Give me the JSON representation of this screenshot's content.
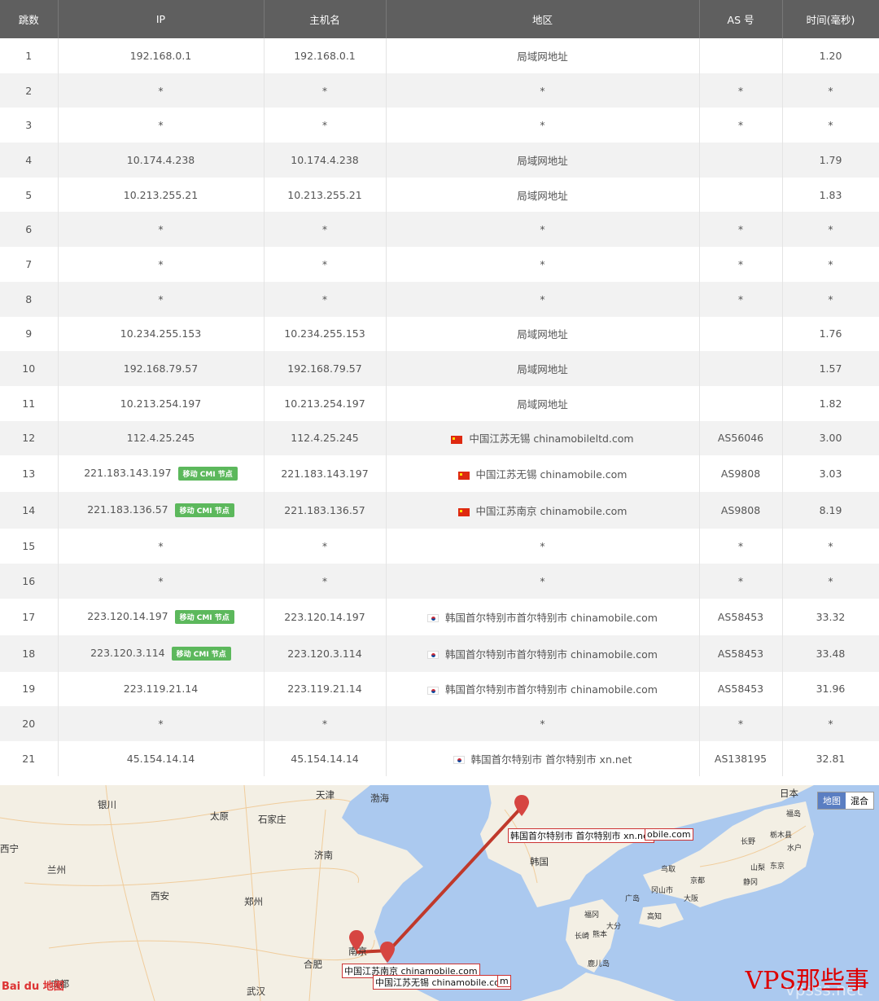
{
  "table": {
    "headers": [
      "跳数",
      "IP",
      "主机名",
      "地区",
      "AS 号",
      "时间(毫秒)"
    ],
    "badge_label": "移动 CMI 节点",
    "rows": [
      {
        "hop": "1",
        "ip": "192.168.0.1",
        "host": "192.168.0.1",
        "region": "局域网地址",
        "flag": "",
        "as": "",
        "time": "1.20",
        "badge": false
      },
      {
        "hop": "2",
        "ip": "*",
        "host": "*",
        "region": "*",
        "flag": "",
        "as": "*",
        "time": "*",
        "badge": false
      },
      {
        "hop": "3",
        "ip": "*",
        "host": "*",
        "region": "*",
        "flag": "",
        "as": "*",
        "time": "*",
        "badge": false
      },
      {
        "hop": "4",
        "ip": "10.174.4.238",
        "host": "10.174.4.238",
        "region": "局域网地址",
        "flag": "",
        "as": "",
        "time": "1.79",
        "badge": false
      },
      {
        "hop": "5",
        "ip": "10.213.255.21",
        "host": "10.213.255.21",
        "region": "局域网地址",
        "flag": "",
        "as": "",
        "time": "1.83",
        "badge": false
      },
      {
        "hop": "6",
        "ip": "*",
        "host": "*",
        "region": "*",
        "flag": "",
        "as": "*",
        "time": "*",
        "badge": false
      },
      {
        "hop": "7",
        "ip": "*",
        "host": "*",
        "region": "*",
        "flag": "",
        "as": "*",
        "time": "*",
        "badge": false
      },
      {
        "hop": "8",
        "ip": "*",
        "host": "*",
        "region": "*",
        "flag": "",
        "as": "*",
        "time": "*",
        "badge": false
      },
      {
        "hop": "9",
        "ip": "10.234.255.153",
        "host": "10.234.255.153",
        "region": "局域网地址",
        "flag": "",
        "as": "",
        "time": "1.76",
        "badge": false
      },
      {
        "hop": "10",
        "ip": "192.168.79.57",
        "host": "192.168.79.57",
        "region": "局域网地址",
        "flag": "",
        "as": "",
        "time": "1.57",
        "badge": false
      },
      {
        "hop": "11",
        "ip": "10.213.254.197",
        "host": "10.213.254.197",
        "region": "局域网地址",
        "flag": "",
        "as": "",
        "time": "1.82",
        "badge": false
      },
      {
        "hop": "12",
        "ip": "112.4.25.245",
        "host": "112.4.25.245",
        "region": "中国江苏无锡 chinamobileltd.com",
        "flag": "cn",
        "as": "AS56046",
        "time": "3.00",
        "badge": false
      },
      {
        "hop": "13",
        "ip": "221.183.143.197",
        "host": "221.183.143.197",
        "region": "中国江苏无锡 chinamobile.com",
        "flag": "cn",
        "as": "AS9808",
        "time": "3.03",
        "badge": true
      },
      {
        "hop": "14",
        "ip": "221.183.136.57",
        "host": "221.183.136.57",
        "region": "中国江苏南京 chinamobile.com",
        "flag": "cn",
        "as": "AS9808",
        "time": "8.19",
        "badge": true
      },
      {
        "hop": "15",
        "ip": "*",
        "host": "*",
        "region": "*",
        "flag": "",
        "as": "*",
        "time": "*",
        "badge": false
      },
      {
        "hop": "16",
        "ip": "*",
        "host": "*",
        "region": "*",
        "flag": "",
        "as": "*",
        "time": "*",
        "badge": false
      },
      {
        "hop": "17",
        "ip": "223.120.14.197",
        "host": "223.120.14.197",
        "region": "韩国首尔特别市首尔特别市 chinamobile.com",
        "flag": "kr",
        "as": "AS58453",
        "time": "33.32",
        "badge": true
      },
      {
        "hop": "18",
        "ip": "223.120.3.114",
        "host": "223.120.3.114",
        "region": "韩国首尔特别市首尔特别市 chinamobile.com",
        "flag": "kr",
        "as": "AS58453",
        "time": "33.48",
        "badge": true
      },
      {
        "hop": "19",
        "ip": "223.119.21.14",
        "host": "223.119.21.14",
        "region": "韩国首尔特别市首尔特别市 chinamobile.com",
        "flag": "kr",
        "as": "AS58453",
        "time": "31.96",
        "badge": false
      },
      {
        "hop": "20",
        "ip": "*",
        "host": "*",
        "region": "*",
        "flag": "",
        "as": "*",
        "time": "*",
        "badge": false
      },
      {
        "hop": "21",
        "ip": "45.154.14.14",
        "host": "45.154.14.14",
        "region": "韩国首尔特别市 首尔特别市 xn.net",
        "flag": "kr",
        "as": "AS138195",
        "time": "32.81",
        "badge": false
      }
    ]
  },
  "map": {
    "type_buttons": [
      "地图",
      "混合"
    ],
    "cities": [
      "银川",
      "太原",
      "石家庄",
      "天津",
      "渤海",
      "兰州",
      "济南",
      "西安",
      "郑州",
      "合肥",
      "南京",
      "武汉",
      "成都",
      "韩国",
      "日本",
      "长野",
      "东京",
      "大阪",
      "京都",
      "福冈",
      "鸟取",
      "冈山市",
      "高知",
      "广岛",
      "熊本",
      "大分",
      "静冈",
      "山梨",
      "栃木县",
      "水户",
      "福岛",
      "鹿儿岛",
      "长崎",
      "西宁"
    ],
    "markers": [
      {
        "label": "韩国首尔特别市 首尔特别市 xn.net"
      },
      {
        "label": "obile.com"
      },
      {
        "label": "中国江苏南京 chinamobile.com"
      },
      {
        "label": "中国江苏无锡 chinamobile.com"
      },
      {
        "label": "m"
      }
    ],
    "route_color": "#c0392b",
    "baidu_logo": "Bai du 地图",
    "watermark": "VPS那些事",
    "watermark_url": "vpsss.net"
  }
}
